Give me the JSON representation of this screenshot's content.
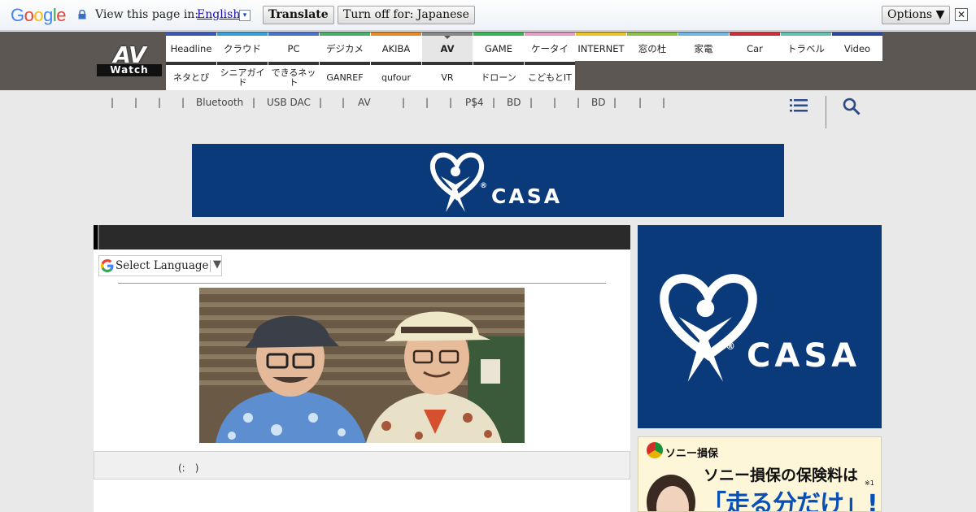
{
  "translate_bar": {
    "logo": "Google",
    "prompt": "View this page in:",
    "language": "English",
    "dropdown_glyph": "▾",
    "translate_label": "Translate",
    "turn_off_label": "Turn off for: Japanese",
    "options_label": "Options ▼",
    "close_glyph": "✕"
  },
  "site": {
    "logo_av": "AV",
    "logo_watch": "Watch"
  },
  "nav": {
    "row1": [
      {
        "label": "Headline",
        "color": "#3a59b5"
      },
      {
        "label": "クラウド",
        "color": "#3a9fd4"
      },
      {
        "label": "PC",
        "color": "#4a73c9"
      },
      {
        "label": "デジカメ",
        "color": "#4cae6b"
      },
      {
        "label": "AKIBA",
        "color": "#e58b2c"
      },
      {
        "label": "AV",
        "color": "#888888",
        "active": true
      },
      {
        "label": "GAME",
        "color": "#3cb35a"
      },
      {
        "label": "ケータイ",
        "color": "#e0a0c4"
      },
      {
        "label": "INTERNET",
        "color": "#e7c42c"
      },
      {
        "label": "窓の杜",
        "color": "#8cc04a"
      },
      {
        "label": "家電",
        "color": "#6fb7e0"
      },
      {
        "label": "Car",
        "color": "#c9303a"
      },
      {
        "label": "トラベル",
        "color": "#66c0b0"
      },
      {
        "label": "Video",
        "color": "#2f4a9a"
      }
    ],
    "row2": [
      {
        "label": "ネタとぴ",
        "color": "#333333"
      },
      {
        "label": "シニアガイド",
        "color": "#333333"
      },
      {
        "label": "できるネット",
        "color": "#333333"
      },
      {
        "label": "GANREF",
        "color": "#333333"
      },
      {
        "label": "qufour",
        "color": "#333333"
      },
      {
        "label": "VR",
        "color": "#333333"
      },
      {
        "label": "ドローン",
        "color": "#333333"
      },
      {
        "label": "こどもとIT",
        "color": "#333333"
      }
    ]
  },
  "subnav": {
    "items": [
      "|",
      "|",
      "|",
      "|",
      "Bluetooth",
      "|",
      "USB DAC",
      "|",
      "|",
      "AV",
      "|",
      "|",
      "|",
      "|",
      "PS4",
      "|",
      "BD",
      "|",
      "|",
      "|",
      "BD",
      "|",
      "|",
      "|"
    ]
  },
  "icons": {
    "menu": "menu-icon",
    "search": "search-icon"
  },
  "banner": {
    "brand": "CASA",
    "registered": "®"
  },
  "article": {
    "language_select": "Select Language",
    "caption": "(:　)"
  },
  "sony_ad": {
    "brand": "ソニー損保",
    "line1": "ソニー損保の保険料は",
    "line2": "「走る分だけ」!",
    "note": "※1"
  },
  "colors": {
    "header_bg": "#5d5754",
    "banner_blue": "#0b3a7a",
    "accent_link": "#1a0dab"
  }
}
